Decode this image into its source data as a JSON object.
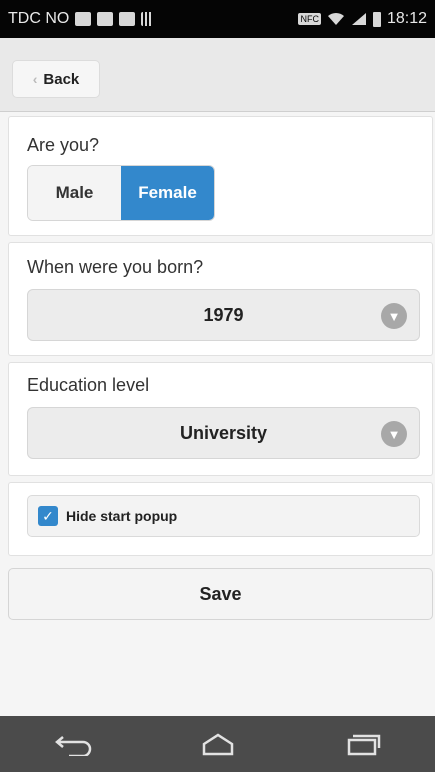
{
  "status_bar": {
    "carrier": "TDC NO",
    "nfc": "NFC",
    "time": "18:12"
  },
  "header": {
    "back_label": "Back"
  },
  "gender": {
    "question": "Are you?",
    "options": [
      "Male",
      "Female"
    ],
    "selected": "Female"
  },
  "birth_year": {
    "question": "When were you born?",
    "value": "1979"
  },
  "education": {
    "question": "Education level",
    "value": "University"
  },
  "popup": {
    "label": "Hide start popup",
    "checked": true
  },
  "save_label": "Save",
  "colors": {
    "accent": "#3388cc",
    "navbar": "#4b4b4b"
  }
}
